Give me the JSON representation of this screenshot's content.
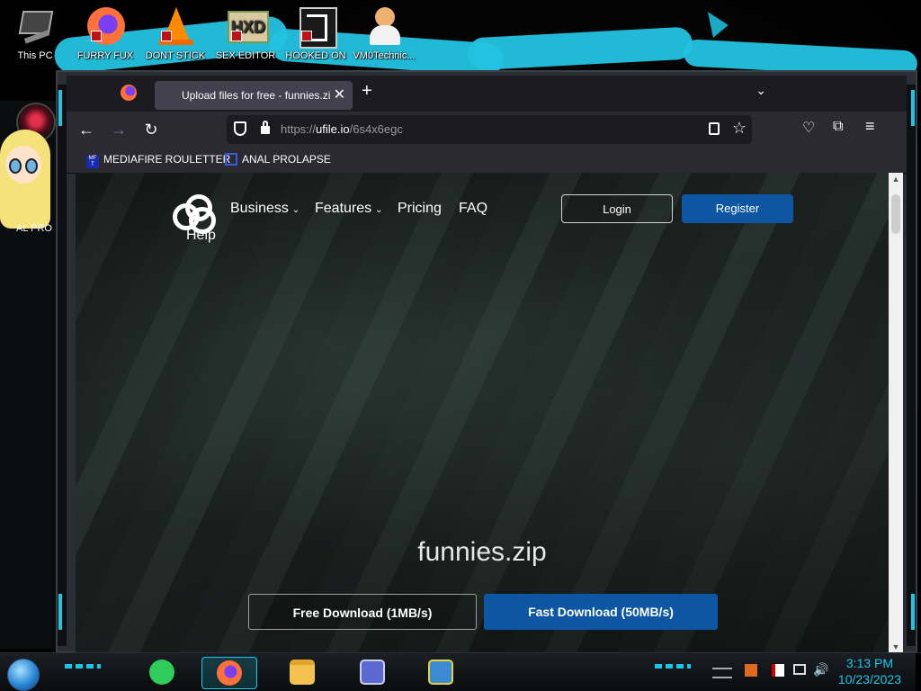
{
  "desktop": {
    "icons": [
      {
        "label": "This PC",
        "icon": "pc-icon"
      },
      {
        "label": "FURRY FUX",
        "icon": "firefox-icon"
      },
      {
        "label": "DONT STICK",
        "icon": "vlc-cone-icon"
      },
      {
        "label": "SEX EDITOR",
        "icon": "hex-editor-icon"
      },
      {
        "label": "HOOKED ON",
        "icon": "game-icon"
      },
      {
        "label": "VM0Technic...",
        "icon": "doctor-icon"
      }
    ],
    "sidebar_text": "AL PRO"
  },
  "browser": {
    "tab": {
      "title": "Upload files for free - funnies.zi",
      "close": "✕"
    },
    "newtab": "+",
    "tablist": "⌄",
    "nav": {
      "back": "←",
      "forward": "→",
      "reload": "↻"
    },
    "url": {
      "prefix": "https://",
      "domain": "ufile.io",
      "path": "/6s4x6egc"
    },
    "star": "☆",
    "tools": {
      "pocket": "♡",
      "extensions": "⧉",
      "menu": "≡"
    },
    "bookmarks": [
      {
        "label": "MEDIAFIRE ROULETTER",
        "icon": "mft-icon"
      },
      {
        "label": "ANAL PROLAPSE",
        "icon": "bookmark-arrow-icon"
      }
    ]
  },
  "page": {
    "nav": [
      {
        "label": "Business",
        "dropdown": true
      },
      {
        "label": "Features",
        "dropdown": true
      },
      {
        "label": "Pricing",
        "dropdown": false
      },
      {
        "label": "FAQ",
        "dropdown": false
      }
    ],
    "caret": "⌄",
    "help": "Help",
    "login": "Login",
    "register": "Register",
    "filename": "funnies.zip",
    "free_download": "Free Download (1MB/s)",
    "fast_download": "Fast Download (50MB/s)",
    "accent": "#0d56a4"
  },
  "taskbar": {
    "apps": [
      {
        "name": "notes-app",
        "icon": "notes-icon"
      },
      {
        "name": "firefox",
        "icon": "firefox-icon"
      },
      {
        "name": "file-explorer",
        "icon": "folder-icon"
      },
      {
        "name": "control-panel",
        "icon": "window-card-icon"
      },
      {
        "name": "tool",
        "icon": "shield-warning-icon"
      }
    ],
    "time": "3:13 PM",
    "date": "10/23/2023",
    "tray": {
      "volume": "🔊"
    },
    "led_color": "#17c9e6"
  }
}
